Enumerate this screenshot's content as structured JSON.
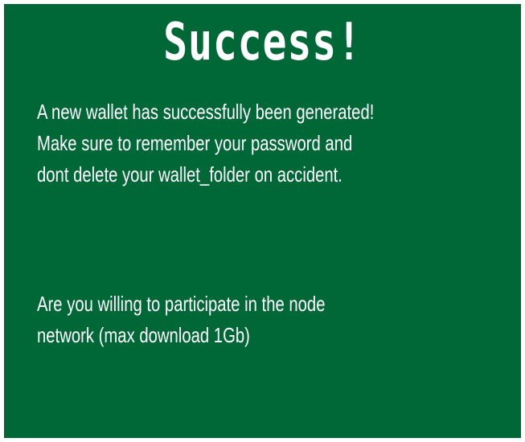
{
  "dialog": {
    "title": "Success!",
    "message_lines": [
      "A new wallet has successfully been generated!",
      "Make sure to remember your password and",
      "dont delete your wallet_folder on accident."
    ],
    "question_lines": [
      "Are you willing to participate in the node",
      "network (max download 1Gb)"
    ],
    "background_color": "#006837",
    "text_color": "#ffffff"
  }
}
